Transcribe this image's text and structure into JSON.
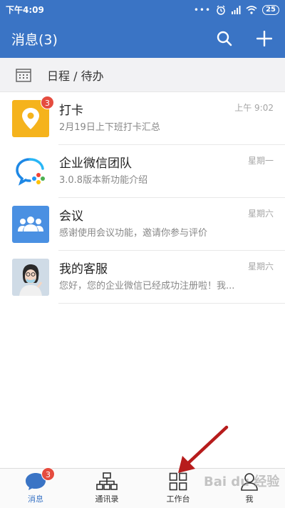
{
  "status_bar": {
    "time": "下午4:09",
    "battery": "25"
  },
  "header": {
    "title": "消息(3)"
  },
  "schedule": {
    "label": "日程 / 待办"
  },
  "messages": [
    {
      "title": "打卡",
      "preview": "2月19日上下班打卡汇总",
      "time": "上午 9:02",
      "badge": "3",
      "icon": "location-pin-icon",
      "color": "#f5b31c"
    },
    {
      "title": "企业微信团队",
      "preview": "3.0.8版本新功能介绍",
      "time": "星期一",
      "badge": "",
      "icon": "wecom-logo-icon",
      "color": "#ffffff"
    },
    {
      "title": "会议",
      "preview": "感谢使用会议功能，邀请你参与评价",
      "time": "星期六",
      "badge": "",
      "icon": "people-icon",
      "color": "#4a90e2"
    },
    {
      "title": "我的客服",
      "preview": "您好，您的企业微信已经成功注册啦！我...",
      "time": "星期六",
      "badge": "",
      "icon": "customer-service-avatar",
      "color": "#c9d6e3"
    }
  ],
  "tabs": [
    {
      "label": "消息",
      "badge": "3",
      "icon": "chat-bubble-icon",
      "active": true
    },
    {
      "label": "通讯录",
      "icon": "org-chart-icon"
    },
    {
      "label": "工作台",
      "icon": "grid-icon"
    },
    {
      "label": "我",
      "icon": "person-icon"
    }
  ],
  "watermark": "Bai du 经验",
  "colors": {
    "brand": "#3a74c5",
    "badge": "#e54c3f",
    "arrow": "#b71c1c"
  }
}
